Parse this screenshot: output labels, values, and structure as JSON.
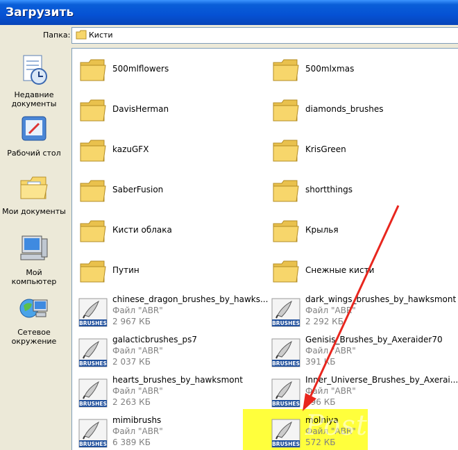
{
  "window": {
    "title": "Загрузить"
  },
  "folder_bar": {
    "label": "Папка:",
    "current": "Кисти"
  },
  "places": [
    {
      "label": "Недавние документы",
      "icon": "recent-documents-icon"
    },
    {
      "label": "Рабочий стол",
      "icon": "desktop-icon"
    },
    {
      "label": "Мои документы",
      "icon": "my-documents-icon"
    },
    {
      "label": "Мой компьютер",
      "icon": "my-computer-icon"
    },
    {
      "label": "Сетевое окружение",
      "icon": "network-places-icon"
    }
  ],
  "folders": [
    "500mlflowers",
    "500mlxmas",
    "DavisHerman",
    "diamonds_brushes",
    "kazuGFX",
    "KrisGreen",
    "SaberFusion",
    "shortthings",
    "Кисти облака",
    "Крылья",
    "Путин",
    "Снежные кисти"
  ],
  "files": [
    {
      "name": "chinese_dragon_brushes_by_hawks...",
      "type": "Файл \"ABR\"",
      "size": "2 967 КБ"
    },
    {
      "name": "dark_wings_brushes_by_hawksmont",
      "type": "Файл \"ABR\"",
      "size": "2 292 КБ"
    },
    {
      "name": "galacticbrushes_ps7",
      "type": "Файл \"ABR\"",
      "size": "2 037 КБ"
    },
    {
      "name": "Genisis_Brushes_by_Axeraider70",
      "type": "Файл \"ABR\"",
      "size": "391 КБ"
    },
    {
      "name": "hearts_brushes_by_hawksmont",
      "type": "Файл \"ABR\"",
      "size": "2 263 КБ"
    },
    {
      "name": "Inner_Universe_Brushes_by_Axerai...",
      "type": "Файл \"ABR\"",
      "size": "896 КБ"
    },
    {
      "name": "mimibrushs",
      "type": "Файл \"ABR\"",
      "size": "6 389 КБ"
    },
    {
      "name": "molniya",
      "type": "Файл \"ABR\"",
      "size": "572 КБ"
    }
  ],
  "brush_badge": "BRUSHES",
  "watermark": "Postila.ru",
  "colors": {
    "title_bar": "#0551d4",
    "highlight": "#ffff3c",
    "arrow": "#e8261e",
    "folder": "#f7d66b"
  }
}
